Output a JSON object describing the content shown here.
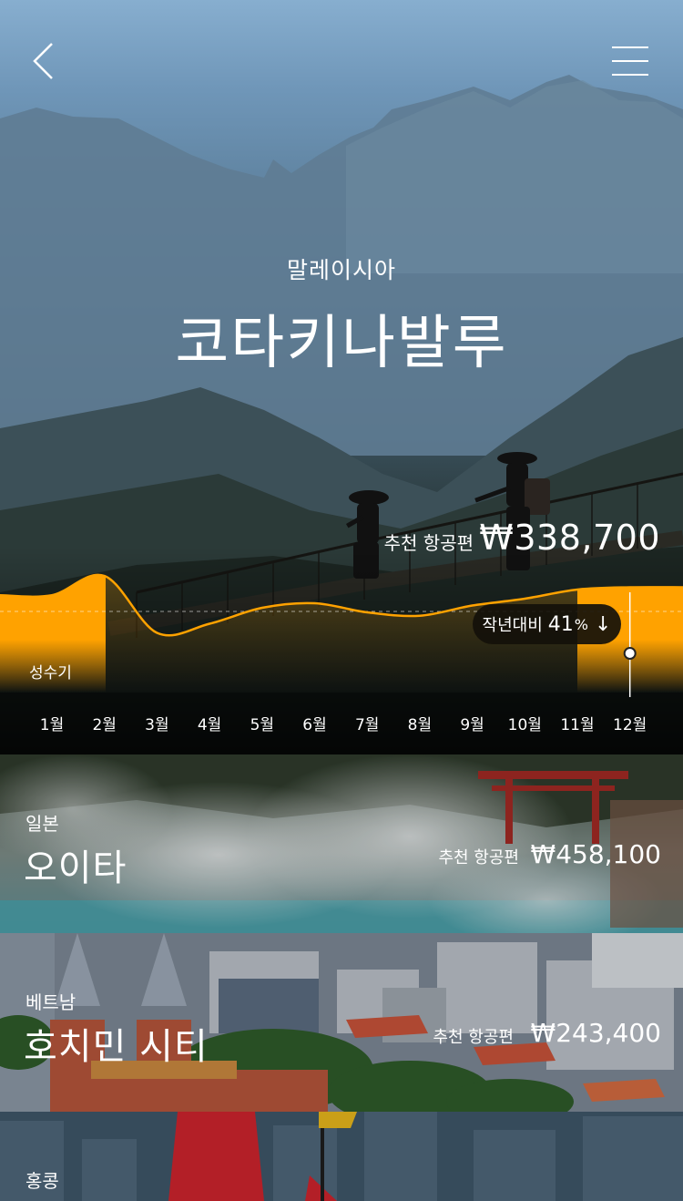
{
  "nav": {
    "back_icon": "chevron-left-icon",
    "menu_icon": "hamburger-icon"
  },
  "destination": {
    "country": "말레이시아",
    "city": "코타키나발루"
  },
  "flight": {
    "label": "추천 항공편",
    "price": "₩338,700"
  },
  "comparison": {
    "label": "작년대비",
    "percent": "41",
    "percent_sign": "%",
    "direction": "↓"
  },
  "season": {
    "peak_label": "성수기"
  },
  "chart_data": {
    "type": "area",
    "categories": [
      "1월",
      "2월",
      "3월",
      "4월",
      "5월",
      "6월",
      "7월",
      "8월",
      "9월",
      "10월",
      "11월",
      "12월"
    ],
    "series": [
      {
        "values": [
          55,
          72,
          22,
          30,
          44,
          48,
          40,
          37,
          46,
          52,
          60,
          62
        ]
      }
    ],
    "highlighted_months": [
      "1월",
      "2월",
      "12월"
    ],
    "selected_month": "12월",
    "accent_color": "#ffa200"
  },
  "cards": [
    {
      "country": "일본",
      "city": "오이타",
      "label": "추천 항공편",
      "price": "₩458,100"
    },
    {
      "country": "베트남",
      "city": "호치민 시티",
      "label": "추천 항공편",
      "price": "₩243,400"
    },
    {
      "country": "홍콩"
    }
  ]
}
